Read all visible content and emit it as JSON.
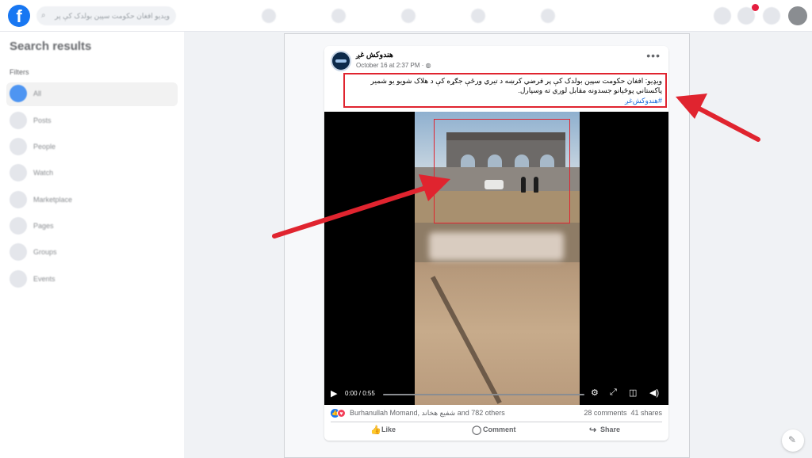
{
  "topbar": {
    "logo_letter": "f",
    "search_text": "ویدیو افغان حکومت سپین بولدک کې پر"
  },
  "sidebar": {
    "title": "Search results",
    "filters_label": "Filters",
    "items": [
      {
        "label": "All",
        "icon": "all-icon"
      },
      {
        "label": "Posts",
        "icon": "posts-icon"
      },
      {
        "label": "People",
        "icon": "people-icon"
      },
      {
        "label": "Watch",
        "icon": "watch-icon"
      },
      {
        "label": "Marketplace",
        "icon": "marketplace-icon"
      },
      {
        "label": "Pages",
        "icon": "pages-icon"
      },
      {
        "label": "Groups",
        "icon": "groups-icon"
      },
      {
        "label": "Events",
        "icon": "events-icon"
      }
    ]
  },
  "post": {
    "author": "هندوکش غږ",
    "meta": "October 16 at 2:37 PM · ",
    "text": "ویډیو: افغان حکومت سپین بولدک کې پر فرضي کرښه د تيري ورځې جګړه کې د هلاک شويو يو شمير پاکستاني پوځيانو جسدونه مقابل لوري ته وسپارل.",
    "hashtag": "#هندوکش‌غږ",
    "video": {
      "current_time": "0:00",
      "duration": "0:55",
      "progress": 0
    },
    "reactions": {
      "names": "Burhanullah Momand, شفیع هخاند and 782 others",
      "comments": "28 comments",
      "shares": "41 shares"
    },
    "actions": {
      "like": "Like",
      "comment": "Comment",
      "share": "Share"
    }
  },
  "colors": {
    "brand": "#1877f2",
    "highlight": "#e0242f",
    "hashtag": "#216fdb"
  }
}
